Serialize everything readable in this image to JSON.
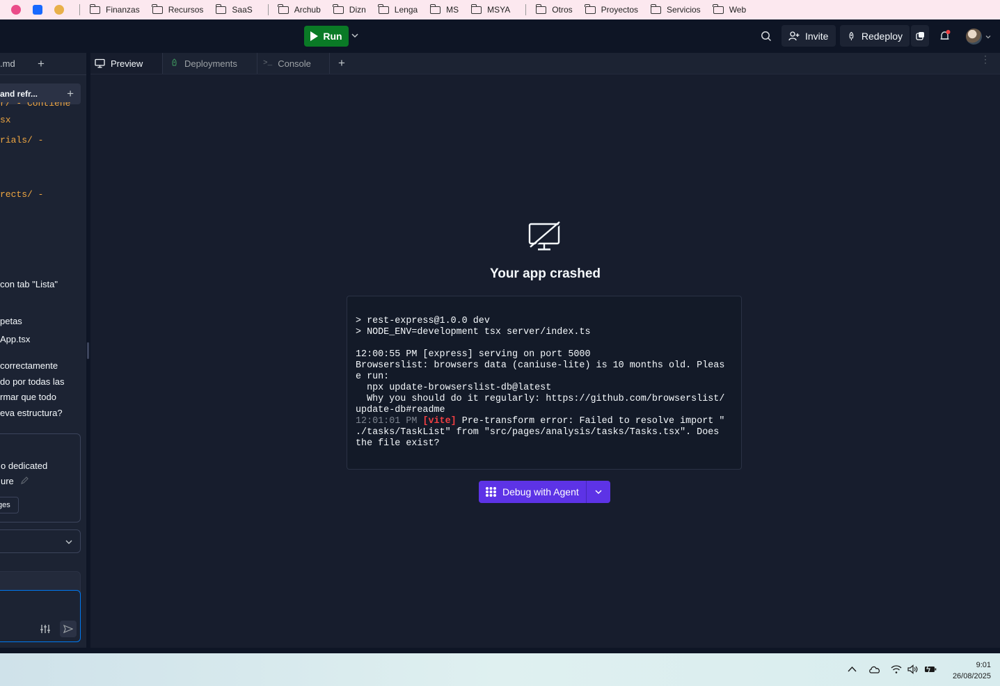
{
  "bookmarks": {
    "items": [
      "Finanzas",
      "Recursos",
      "SaaS",
      "Archub",
      "Dizn",
      "Lenga",
      "MS",
      "MSYA",
      "Otros",
      "Proyectos",
      "Servicios",
      "Web"
    ]
  },
  "topbar": {
    "run_label": "Run",
    "invite_label": "Invite",
    "redeploy_label": "Redeploy"
  },
  "left_panel": {
    "tab_name": ".md",
    "chat_title": "and refr...",
    "lines": [
      {
        "text": "r/  - Contiene",
        "kind": "code"
      },
      {
        "text": "sx",
        "kind": "code"
      },
      {
        "text": "rials/ -",
        "kind": "code"
      },
      {
        "text": "rects/ -",
        "kind": "code"
      },
      {
        "text": "con tab \"Lista\"",
        "kind": "text"
      },
      {
        "text": "petas",
        "kind": "text"
      },
      {
        "text": " App.tsx",
        "kind": "text"
      },
      {
        "text": "correctamente",
        "kind": "text"
      },
      {
        "text": "do por todas las",
        "kind": "text"
      },
      {
        "text": "rmar que todo",
        "kind": "text"
      },
      {
        "text": "eva estructura?",
        "kind": "text"
      }
    ],
    "card_line1": "o dedicated",
    "card_line2": "ure",
    "chip_label": "ges"
  },
  "right_panel": {
    "tabs": [
      {
        "label": "Preview",
        "icon": "monitor-icon"
      },
      {
        "label": "Deployments",
        "icon": "rocket-icon"
      },
      {
        "label": "Console",
        "icon": "terminal-icon"
      }
    ],
    "crash_title": "Your app crashed",
    "log": {
      "line1": "> rest-express@1.0.0 dev",
      "line2": "> NODE_ENV=development tsx server/index.ts",
      "line3": "12:00:55 PM [express] serving on port 5000",
      "line4": "Browserslist: browsers data (caniuse-lite) is 10 months old. Pleas",
      "line5": "e run:",
      "line6": "  npx update-browserslist-db@latest",
      "line7": "  Why you should do it regularly: https://github.com/browserslist/",
      "line8": "update-db#readme",
      "line9_time": "12:01:01 PM",
      "line9_tag": "[vite]",
      "line9_rest": " Pre-transform error: Failed to resolve import \"",
      "line10": "./tasks/TaskList\" from \"src/pages/analysis/tasks/Tasks.tsx\". Does",
      "line11": "the file exist?"
    },
    "debug_label": "Debug with Agent"
  },
  "taskbar": {
    "time": "9:01",
    "date": "26/08/2025"
  },
  "colors": {
    "run_green": "#0a7a26",
    "debug_purple": "#5d33e6",
    "error_red": "#f23f42",
    "bg_dark": "#0e1525"
  }
}
